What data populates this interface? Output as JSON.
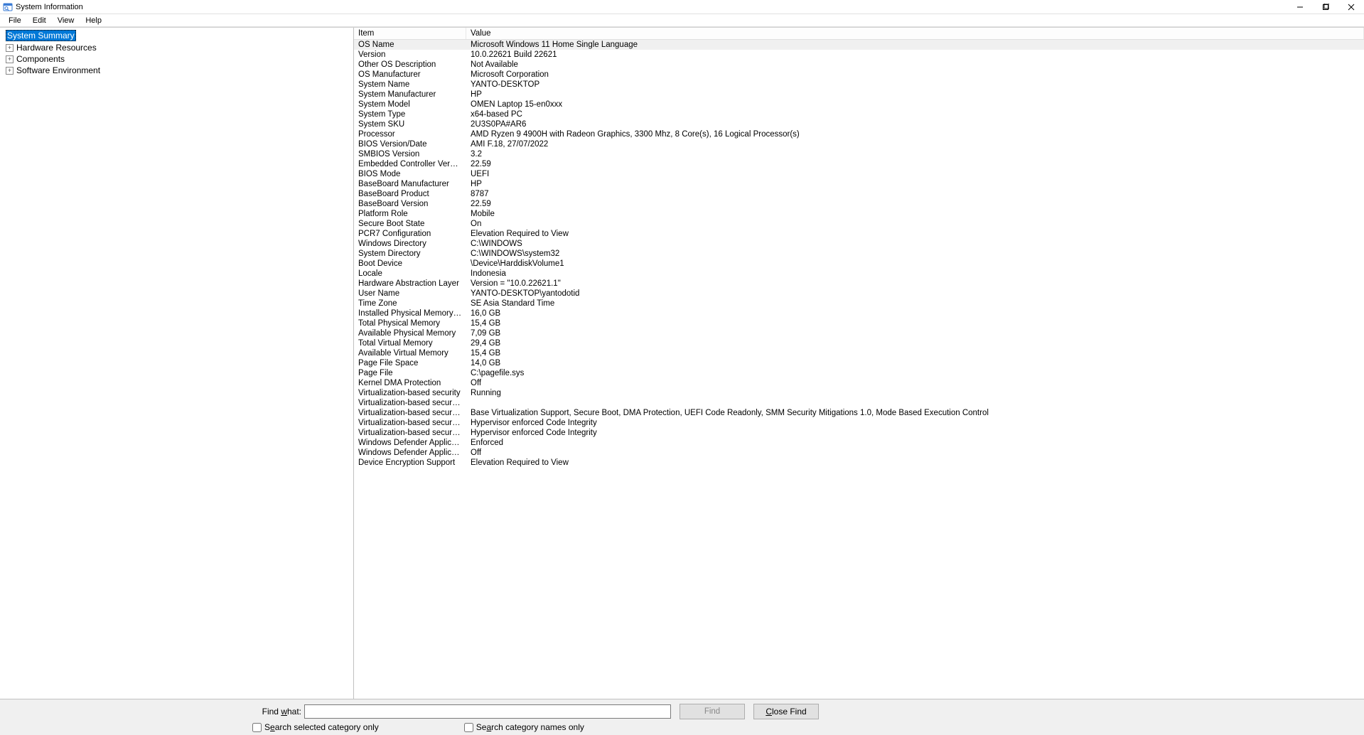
{
  "titlebar": {
    "title": "System Information"
  },
  "menubar": {
    "file": "File",
    "edit": "Edit",
    "view": "View",
    "help": "Help"
  },
  "tree": {
    "system_summary": "System Summary",
    "hardware_resources": "Hardware Resources",
    "components": "Components",
    "software_environment": "Software Environment",
    "expander": "+"
  },
  "headers": {
    "item": "Item",
    "value": "Value"
  },
  "rows": [
    {
      "item": "OS Name",
      "value": "Microsoft Windows 11 Home Single Language"
    },
    {
      "item": "Version",
      "value": "10.0.22621 Build 22621"
    },
    {
      "item": "Other OS Description",
      "value": "Not Available"
    },
    {
      "item": "OS Manufacturer",
      "value": "Microsoft Corporation"
    },
    {
      "item": "System Name",
      "value": "YANTO-DESKTOP"
    },
    {
      "item": "System Manufacturer",
      "value": "HP"
    },
    {
      "item": "System Model",
      "value": "OMEN Laptop 15-en0xxx"
    },
    {
      "item": "System Type",
      "value": "x64-based PC"
    },
    {
      "item": "System SKU",
      "value": "2U3S0PA#AR6"
    },
    {
      "item": "Processor",
      "value": "AMD Ryzen 9 4900H with Radeon Graphics, 3300 Mhz, 8 Core(s), 16 Logical Processor(s)"
    },
    {
      "item": "BIOS Version/Date",
      "value": "AMI F.18, 27/07/2022"
    },
    {
      "item": "SMBIOS Version",
      "value": "3.2"
    },
    {
      "item": "Embedded Controller Version",
      "value": "22.59"
    },
    {
      "item": "BIOS Mode",
      "value": "UEFI"
    },
    {
      "item": "BaseBoard Manufacturer",
      "value": "HP"
    },
    {
      "item": "BaseBoard Product",
      "value": "8787"
    },
    {
      "item": "BaseBoard Version",
      "value": "22.59"
    },
    {
      "item": "Platform Role",
      "value": "Mobile"
    },
    {
      "item": "Secure Boot State",
      "value": "On"
    },
    {
      "item": "PCR7 Configuration",
      "value": "Elevation Required to View"
    },
    {
      "item": "Windows Directory",
      "value": "C:\\WINDOWS"
    },
    {
      "item": "System Directory",
      "value": "C:\\WINDOWS\\system32"
    },
    {
      "item": "Boot Device",
      "value": "\\Device\\HarddiskVolume1"
    },
    {
      "item": "Locale",
      "value": "Indonesia"
    },
    {
      "item": "Hardware Abstraction Layer",
      "value": "Version = \"10.0.22621.1\""
    },
    {
      "item": "User Name",
      "value": "YANTO-DESKTOP\\yantodotid"
    },
    {
      "item": "Time Zone",
      "value": "SE Asia Standard Time"
    },
    {
      "item": "Installed Physical Memory (RAM)",
      "value": "16,0 GB"
    },
    {
      "item": "Total Physical Memory",
      "value": "15,4 GB"
    },
    {
      "item": "Available Physical Memory",
      "value": "7,09 GB"
    },
    {
      "item": "Total Virtual Memory",
      "value": "29,4 GB"
    },
    {
      "item": "Available Virtual Memory",
      "value": "15,4 GB"
    },
    {
      "item": "Page File Space",
      "value": "14,0 GB"
    },
    {
      "item": "Page File",
      "value": "C:\\pagefile.sys"
    },
    {
      "item": "Kernel DMA Protection",
      "value": "Off"
    },
    {
      "item": "Virtualization-based security",
      "value": "Running"
    },
    {
      "item": "Virtualization-based security Re...",
      "value": ""
    },
    {
      "item": "Virtualization-based security Av...",
      "value": "Base Virtualization Support, Secure Boot, DMA Protection, UEFI Code Readonly, SMM Security Mitigations 1.0, Mode Based Execution Control"
    },
    {
      "item": "Virtualization-based security Se...",
      "value": "Hypervisor enforced Code Integrity"
    },
    {
      "item": "Virtualization-based security Se...",
      "value": "Hypervisor enforced Code Integrity"
    },
    {
      "item": "Windows Defender Application...",
      "value": "Enforced"
    },
    {
      "item": "Windows Defender Application...",
      "value": "Off"
    },
    {
      "item": "Device Encryption Support",
      "value": "Elevation Required to View"
    }
  ],
  "findbar": {
    "label_prefix": "Find ",
    "label_uchar": "w",
    "label_suffix": "hat:",
    "find_btn": "Find",
    "close_btn_prefix": "",
    "close_btn_uchar": "C",
    "close_btn_suffix": "lose Find",
    "cb1_prefix": "S",
    "cb1_uchar": "e",
    "cb1_suffix": "arch selected category only",
    "cb2_prefix": "Se",
    "cb2_uchar": "a",
    "cb2_suffix": "rch category names only"
  }
}
